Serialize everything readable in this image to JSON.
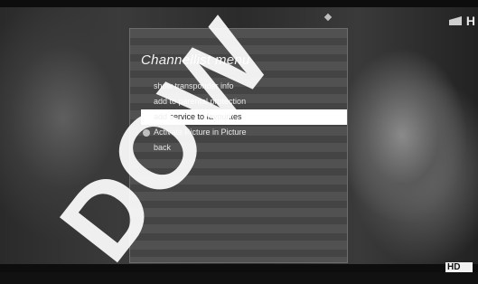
{
  "osd": {
    "title": "Channellist menu",
    "items": [
      {
        "label": "show transponder info",
        "selected": false
      },
      {
        "label": "add to parental protection",
        "selected": false
      },
      {
        "label": "add service to favourites",
        "selected": true
      },
      {
        "label": "Activate Picture in Picture",
        "selected": false
      },
      {
        "label": "back",
        "selected": false
      }
    ]
  },
  "tv": {
    "channel_logo_letter": "H",
    "hd_badge": "HD"
  },
  "watermark": {
    "text": "DOW"
  },
  "colors": {
    "panel_bg": "#4b4b4b",
    "highlight": "#ffffff",
    "text": "#e6e6e6"
  }
}
